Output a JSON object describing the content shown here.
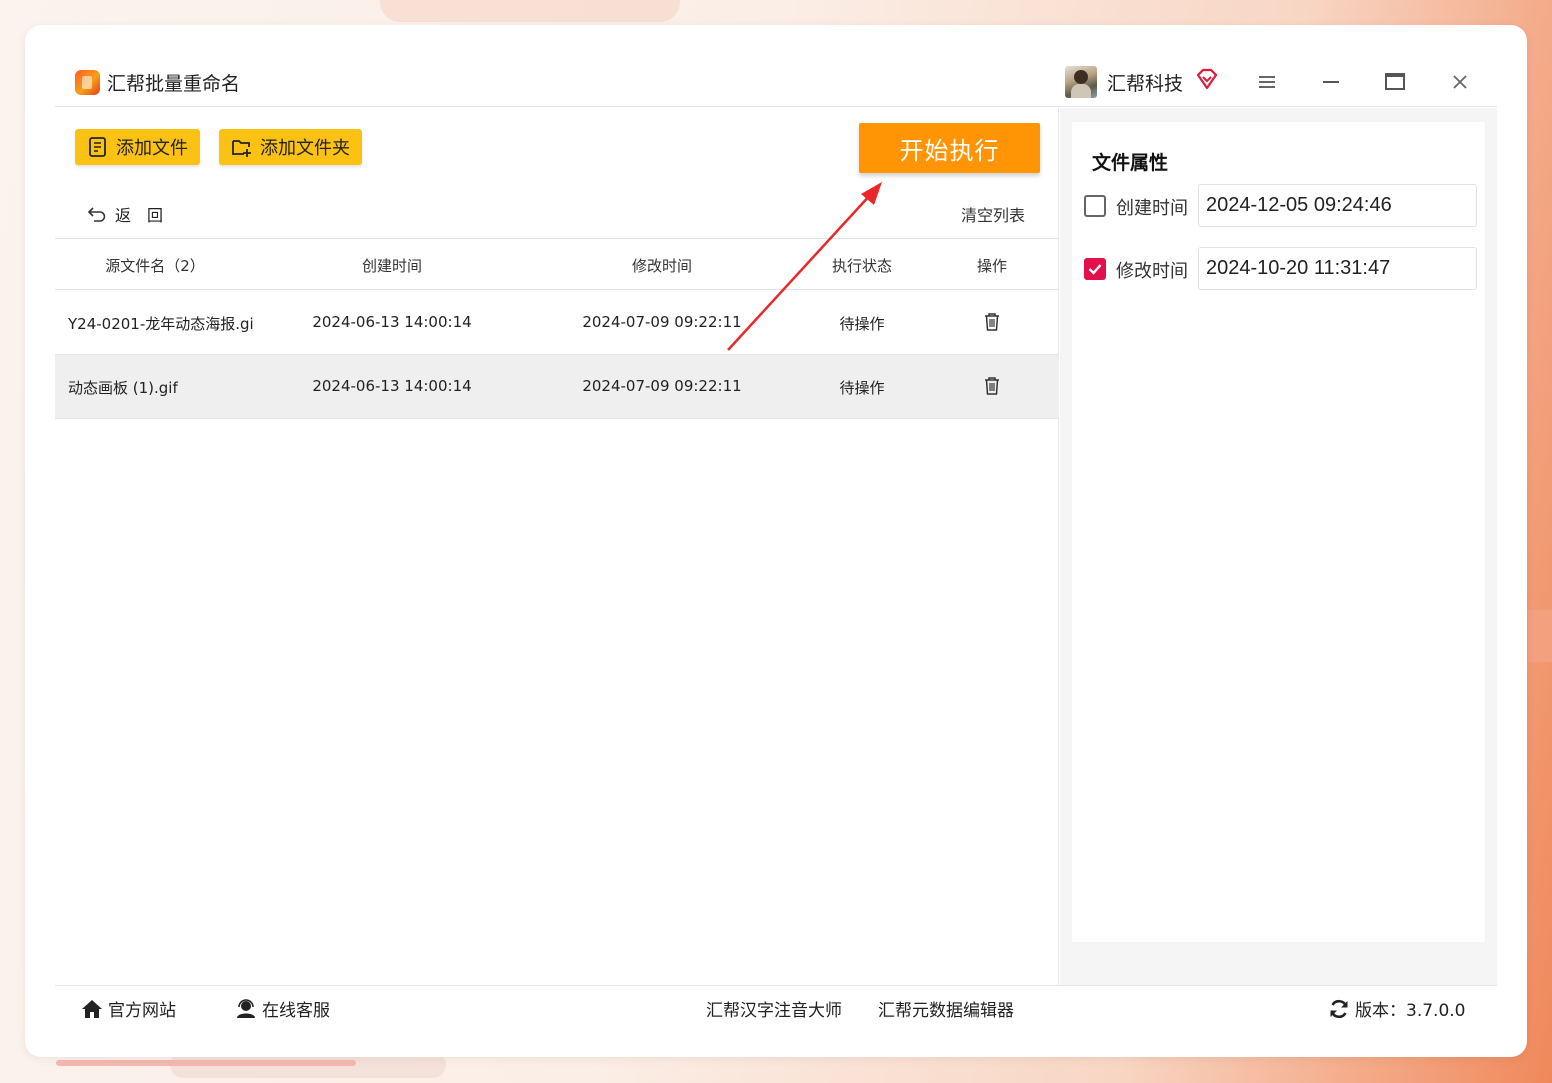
{
  "app": {
    "title": "汇帮批量重命名"
  },
  "user": {
    "name": "汇帮科技"
  },
  "toolbar": {
    "add_file": "添加文件",
    "add_folder": "添加文件夹",
    "start": "开始执行",
    "back": "返回",
    "clear": "清空列表"
  },
  "table": {
    "headers": [
      "源文件名（2）",
      "创建时间",
      "修改时间",
      "执行状态",
      "操作"
    ],
    "rows": [
      {
        "name": "Y24-0201-龙年动态海报.gi",
        "created": "2024-06-13 14:00:14",
        "modified": "2024-07-09 09:22:11",
        "status": "待操作"
      },
      {
        "name": "动态画板 (1).gif",
        "created": "2024-06-13 14:00:14",
        "modified": "2024-07-09 09:22:11",
        "status": "待操作"
      }
    ]
  },
  "properties": {
    "title": "文件属性",
    "created": {
      "label": "创建时间",
      "checked": false,
      "value": "2024-12-05 09:24:46"
    },
    "modified": {
      "label": "修改时间",
      "checked": true,
      "value": "2024-10-20 11:31:47"
    }
  },
  "footer": {
    "website": "官方网站",
    "support": "在线客服",
    "pinyin_tool": "汇帮汉字注音大师",
    "metadata_tool": "汇帮元数据编辑器",
    "version": "版本：3.7.0.0"
  },
  "colors": {
    "toolbar_button": "#fcc213",
    "start_button": "#ff9505",
    "checkbox_on": "#e3114b",
    "annotation_arrow": "#e8282a"
  }
}
